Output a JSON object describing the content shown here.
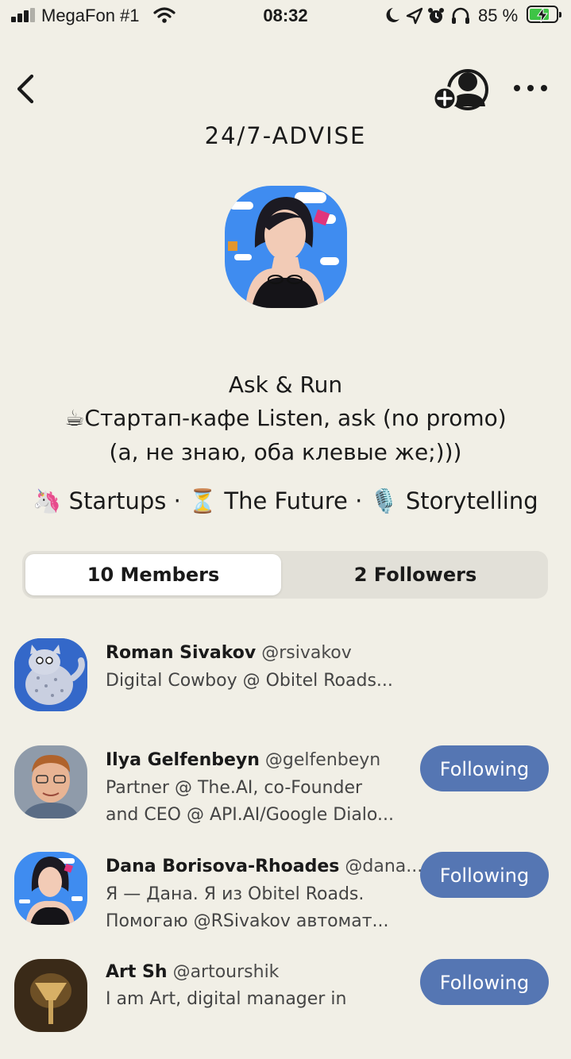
{
  "status_bar": {
    "carrier": "MegaFon #1",
    "time": "08:32",
    "battery_percent": "85 %",
    "icons": [
      "signal-icon",
      "wifi-icon",
      "moon-icon",
      "location-arrow-icon",
      "alarm-icon",
      "headphones-icon",
      "battery-charging-icon"
    ]
  },
  "nav": {
    "back_icon": "chevron-left-icon",
    "add_member_icon": "add-user-icon",
    "more_icon": "more-horizontal-icon"
  },
  "club": {
    "title": "24/7-ADVISE",
    "description": [
      "Ask & Run",
      "☕Стартап-кафе Listen, ask (no promo)",
      "(а, не знаю, оба клевые же;)))"
    ],
    "topics": "🦄 Startups · ⏳ The Future · 🎙️ Storytelling"
  },
  "tabs": {
    "members": "10 Members",
    "followers": "2 Followers",
    "active": "members"
  },
  "members": [
    {
      "name": "Roman Sivakov",
      "handle": "@rsivakov",
      "bio": [
        "Digital Cowboy @ Obitel Roads..."
      ],
      "button": ""
    },
    {
      "name": "Ilya Gelfenbeyn",
      "handle": "@gelfenbeyn",
      "bio": [
        "Partner @ The.AI, co-Founder",
        "and CEO @ API.AI/Google Dialo..."
      ],
      "button": "Following"
    },
    {
      "name": "Dana Borisova-Rhoades",
      "handle": "@dana...",
      "bio": [
        "Я — Дана. Я из Obitel Roads.",
        "Помогаю @RSivakov автомат..."
      ],
      "button": "Following"
    },
    {
      "name": "Art Sh",
      "handle": "@artourshik",
      "bio": [
        "I am Art, digital manager in"
      ],
      "button": "Following"
    }
  ],
  "colors": {
    "background": "#f1efe6",
    "follow_button": "#5576b3",
    "battery_fill": "#3ec446"
  }
}
